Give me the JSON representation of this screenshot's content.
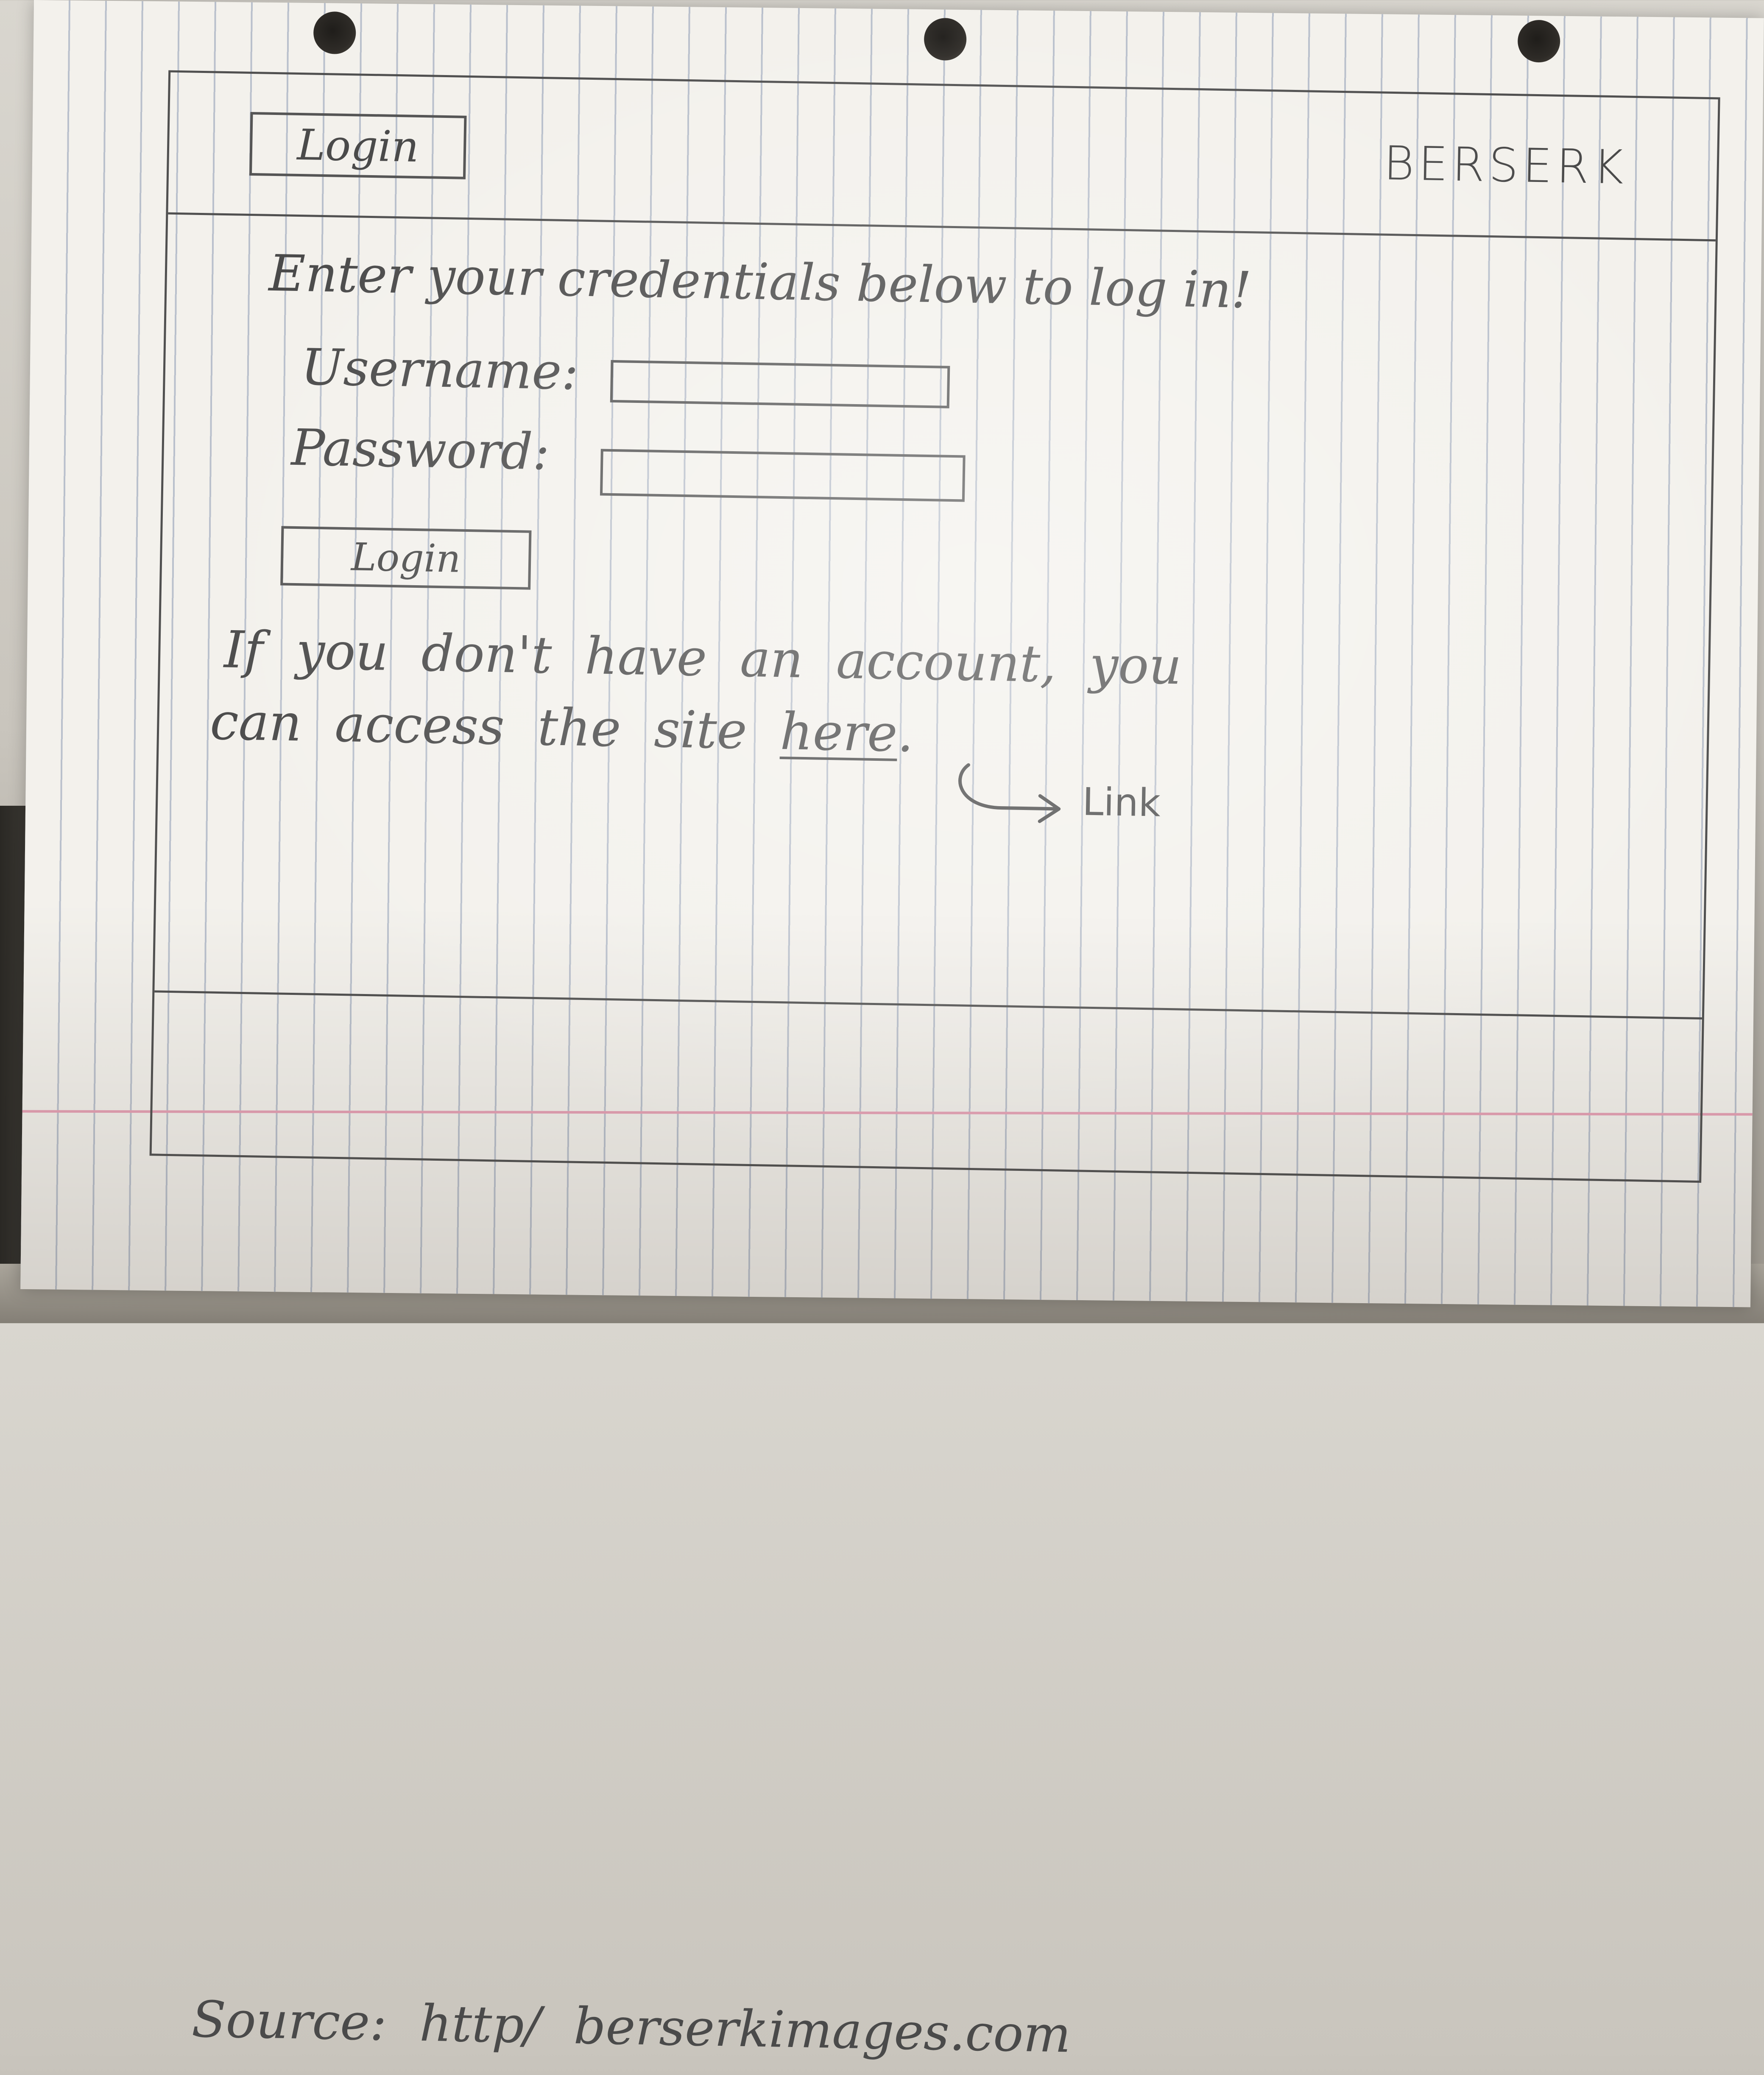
{
  "header": {
    "login_button": "Login",
    "brand": "BERSERK"
  },
  "form": {
    "intro": "Enter your credentials below to log in!",
    "username_label": "Username:",
    "password_label": "Password:",
    "login_button": "Login"
  },
  "info": {
    "line1": "If you don't have an account, you",
    "line2_prefix": "can access the site",
    "link_text": "here",
    "line2_suffix": ".",
    "annotation": "Link"
  },
  "footer": {
    "source": "Source: http/ berserkimages.com"
  },
  "colors": {
    "ink": "#4a4a4a",
    "paper": "#f3f1ec",
    "margin_line": "#e6a1b5"
  }
}
